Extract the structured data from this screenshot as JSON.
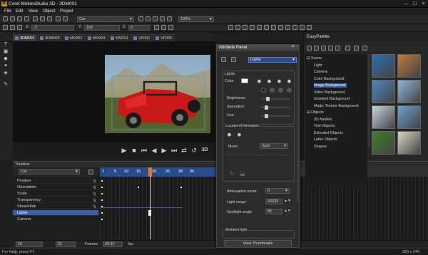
{
  "window": {
    "app_icon": "3D",
    "title": "Corel MotionStudio 3D - 3DM001"
  },
  "menu": [
    "File",
    "Edit",
    "View",
    "Object",
    "Project"
  ],
  "toolbar": {
    "object_select": "Car",
    "zoom_value": "100%",
    "x_label": "X:",
    "x_value": "-2",
    "y_label": "Y:",
    "y_value": "166",
    "z_label": "Z:",
    "z_value": "0"
  },
  "doc_tabs": [
    "3DM001",
    "3DM005",
    "MV002",
    "MV004",
    "MV013",
    "VF002",
    "VF005"
  ],
  "timeline": {
    "title": "Timeline",
    "object": "Car",
    "ruler": [
      "1",
      "5",
      "10",
      "15",
      "20",
      "25",
      "30",
      "35"
    ],
    "tracks": [
      "Position",
      "Orientation",
      "Scale",
      "Transparency",
      "Show/Hide",
      "Lights",
      "Camera"
    ],
    "selected_track": "Lights",
    "frame": "10",
    "total": "31",
    "frames_label": "Frames",
    "fps": "29.97",
    "fps_label": "fps"
  },
  "attribute_panel": {
    "title": "Attribute Panel",
    "light_select": "Lights",
    "lights_section": "Lights",
    "color_label": "Color",
    "brightness_label": "Brightness:",
    "saturation_label": "Saturation:",
    "hue_label": "Hue:",
    "location_section": "Location/Orientation",
    "mode_label": "Mode:",
    "mode_value": "Spot",
    "attenuation_label": "Attenuation mode:",
    "attenuation_value": "0",
    "light_range_label": "Light range:",
    "light_range_value": "60535",
    "spotlight_label": "Spotlight angle:",
    "spotlight_value": "80",
    "ambient_section": "Ambient light",
    "view_thumbnails": "View Thumbnails"
  },
  "easy_palette": {
    "title": "EasyPalette",
    "tree": [
      {
        "label": "Scene",
        "level": 0
      },
      {
        "label": "Light",
        "level": 1
      },
      {
        "label": "Camera",
        "level": 1
      },
      {
        "label": "Color Background",
        "level": 1
      },
      {
        "label": "Image Background",
        "level": 1,
        "selected": true
      },
      {
        "label": "Video Background",
        "level": 1
      },
      {
        "label": "Gradient Background",
        "level": 1
      },
      {
        "label": "Magic Texture Background",
        "level": 1
      },
      {
        "label": "Objects",
        "level": 0
      },
      {
        "label": "3D Models",
        "level": 1
      },
      {
        "label": "Text Objects",
        "level": 1
      },
      {
        "label": "Extruded Objects",
        "level": 1
      },
      {
        "label": "Lathe Objects",
        "level": 1
      },
      {
        "label": "Shapes",
        "level": 1
      }
    ],
    "thumb_colors": [
      "#2e6fb0",
      "#c07a3a",
      "#4f86c4",
      "#8fb6d8",
      "#c8d6e0",
      "#6aa2d0",
      "#3f7d2a",
      "#d9d5c2"
    ]
  },
  "status": {
    "help": "For Help, press F1",
    "size": "320 x 240"
  }
}
